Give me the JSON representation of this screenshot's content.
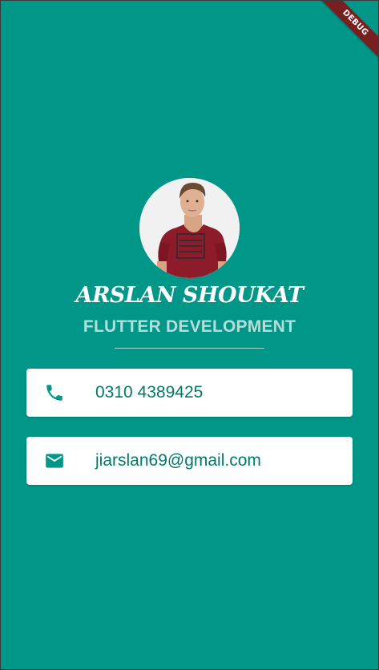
{
  "debug_banner": "DEBUG",
  "profile": {
    "name": "ARSLAN SHOUKAT",
    "title": "FLUTTER DEVELOPMENT"
  },
  "contacts": [
    {
      "type": "phone",
      "icon": "phone-icon",
      "value": "0310 4389425"
    },
    {
      "type": "email",
      "icon": "mail-icon",
      "value": "jiarslan69@gmail.com"
    }
  ],
  "colors": {
    "background": "#009688",
    "card": "#ffffff",
    "accent": "#00796b",
    "subtitle": "#b2dfdb",
    "debug_ribbon": "#7a1f1f"
  }
}
